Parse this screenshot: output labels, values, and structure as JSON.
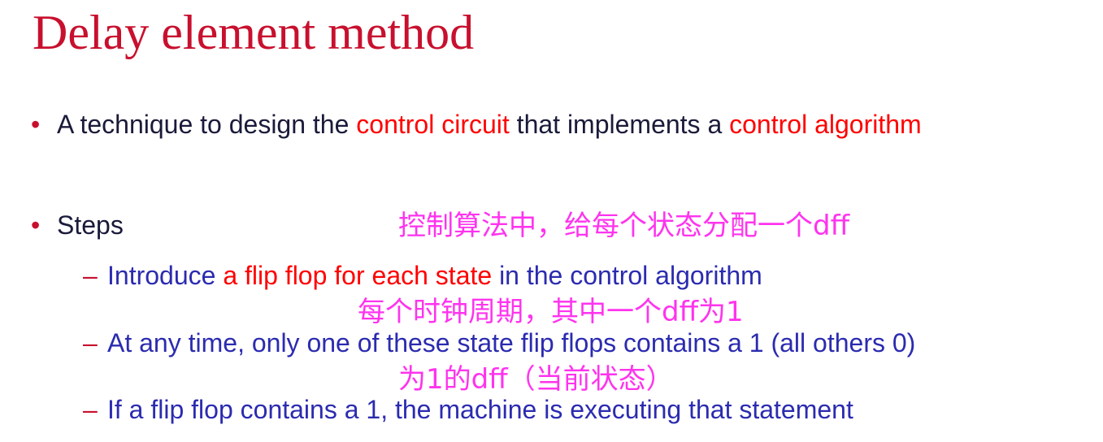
{
  "slide": {
    "title": "Delay element method",
    "bullet1": {
      "marker": "•",
      "part1": "A technique to design the ",
      "part2": "control circuit",
      "part3": " that implements a ",
      "part4": "control algorithm"
    },
    "bullet2": {
      "marker": "•",
      "text": "Steps"
    },
    "sub1": {
      "marker": "–",
      "part1": "Introduce ",
      "part2": "a flip flop for each state",
      "part3": " in the control algorithm"
    },
    "sub2": {
      "marker": "–",
      "text": "At any time, only one of these state flip flops contains a 1 (all others 0)"
    },
    "sub3": {
      "marker": "–",
      "text": "If a flip flop contains a 1, the machine is executing that statement"
    },
    "annotations": {
      "note1": "控制算法中，给每个状态分配一个dff",
      "note2": "每个时钟周期，其中一个dff为1",
      "note3": "为1的dff（当前状态）"
    }
  },
  "colors": {
    "title": "#c8102e",
    "body_text": "#1a1a3a",
    "sub_text": "#2b2bb0",
    "highlight": "#ff0000",
    "annotation": "#ff33ee"
  }
}
